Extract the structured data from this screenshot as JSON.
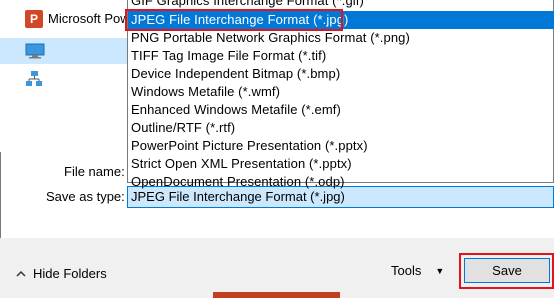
{
  "nav": {
    "items": [
      {
        "label": "Microsoft PowerPoint",
        "icon": "powerpoint-icon"
      },
      {
        "label": "",
        "icon": "computer-icon"
      },
      {
        "label": "",
        "icon": "network-icon"
      }
    ]
  },
  "dropdown": {
    "options": [
      "GIF Graphics Interchange Format (*.gif)",
      "JPEG File Interchange Format (*.jpg)",
      "PNG Portable Network Graphics Format (*.png)",
      "TIFF Tag Image File Format (*.tif)",
      "Device Independent Bitmap (*.bmp)",
      "Windows Metafile (*.wmf)",
      "Enhanced Windows Metafile (*.emf)",
      "Outline/RTF (*.rtf)",
      "PowerPoint Picture Presentation (*.pptx)",
      "Strict Open XML Presentation (*.pptx)",
      "OpenDocument Presentation (*.odp)"
    ],
    "selected_index": 1
  },
  "form": {
    "file_name_label": "File name:",
    "file_name_value": "",
    "save_as_type_label": "Save as type:",
    "save_as_type_value": "JPEG File Interchange Format (*.jpg)"
  },
  "footer": {
    "hide_folders_label": "Hide Folders",
    "tools_label": "Tools",
    "save_label": "Save"
  },
  "colors": {
    "highlight": "#0078d7",
    "annotation_red": "#e1141e",
    "powerpoint": "#d24726"
  }
}
